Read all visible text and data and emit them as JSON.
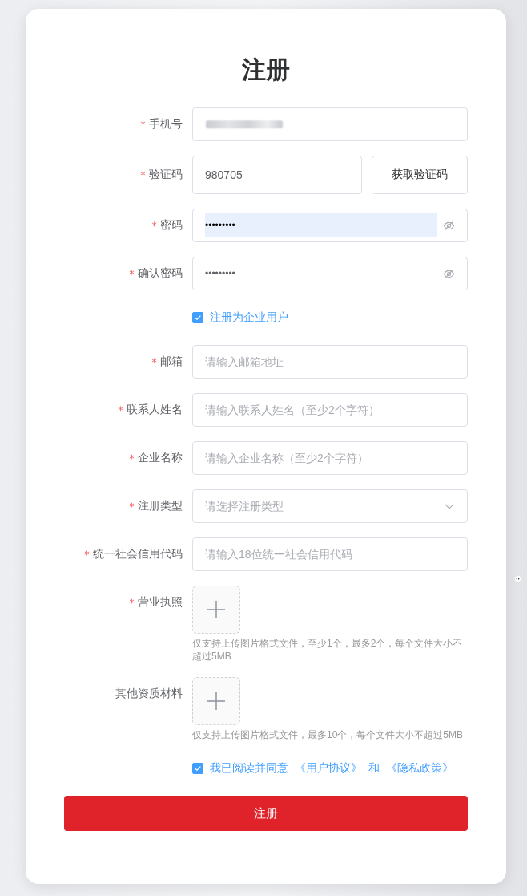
{
  "title": "注册",
  "fields": [
    {
      "kind": "text",
      "label": "手机号",
      "required": true,
      "value_redacted": true
    },
    {
      "kind": "code",
      "label": "验证码",
      "required": true,
      "value": "980705",
      "button": "获取验证码"
    },
    {
      "kind": "password",
      "label": "密码",
      "required": true,
      "value": "•••••••••",
      "autofilled": true
    },
    {
      "kind": "password",
      "label": "确认密码",
      "required": true,
      "value": "•••••••••",
      "autofilled": false
    },
    {
      "kind": "checkbox",
      "label": "注册为企业用户",
      "checked": true
    },
    {
      "kind": "text",
      "label": "邮箱",
      "required": true,
      "placeholder": "请输入邮箱地址"
    },
    {
      "kind": "text",
      "label": "联系人姓名",
      "required": true,
      "placeholder": "请输入联系人姓名（至少2个字符）"
    },
    {
      "kind": "text",
      "label": "企业名称",
      "required": true,
      "placeholder": "请输入企业名称（至少2个字符）"
    },
    {
      "kind": "select",
      "label": "注册类型",
      "required": true,
      "placeholder": "请选择注册类型"
    },
    {
      "kind": "text",
      "label": "统一社会信用代码",
      "required": true,
      "placeholder": "请输入18位统一社会信用代码"
    },
    {
      "kind": "upload",
      "label": "营业执照",
      "required": true,
      "hint": "仅支持上传图片格式文件，至少1个，最多2个，每个文件大小不超过5MB"
    },
    {
      "kind": "upload",
      "label": "其他资质材料",
      "required": false,
      "hint": "仅支持上传图片格式文件，最多10个，每个文件大小不超过5MB"
    }
  ],
  "agreement": {
    "checked": true,
    "text": "我已阅读并同意",
    "links": [
      "《用户协议》",
      "《隐私政策》"
    ],
    "joiner": "和"
  },
  "submit": "注册"
}
